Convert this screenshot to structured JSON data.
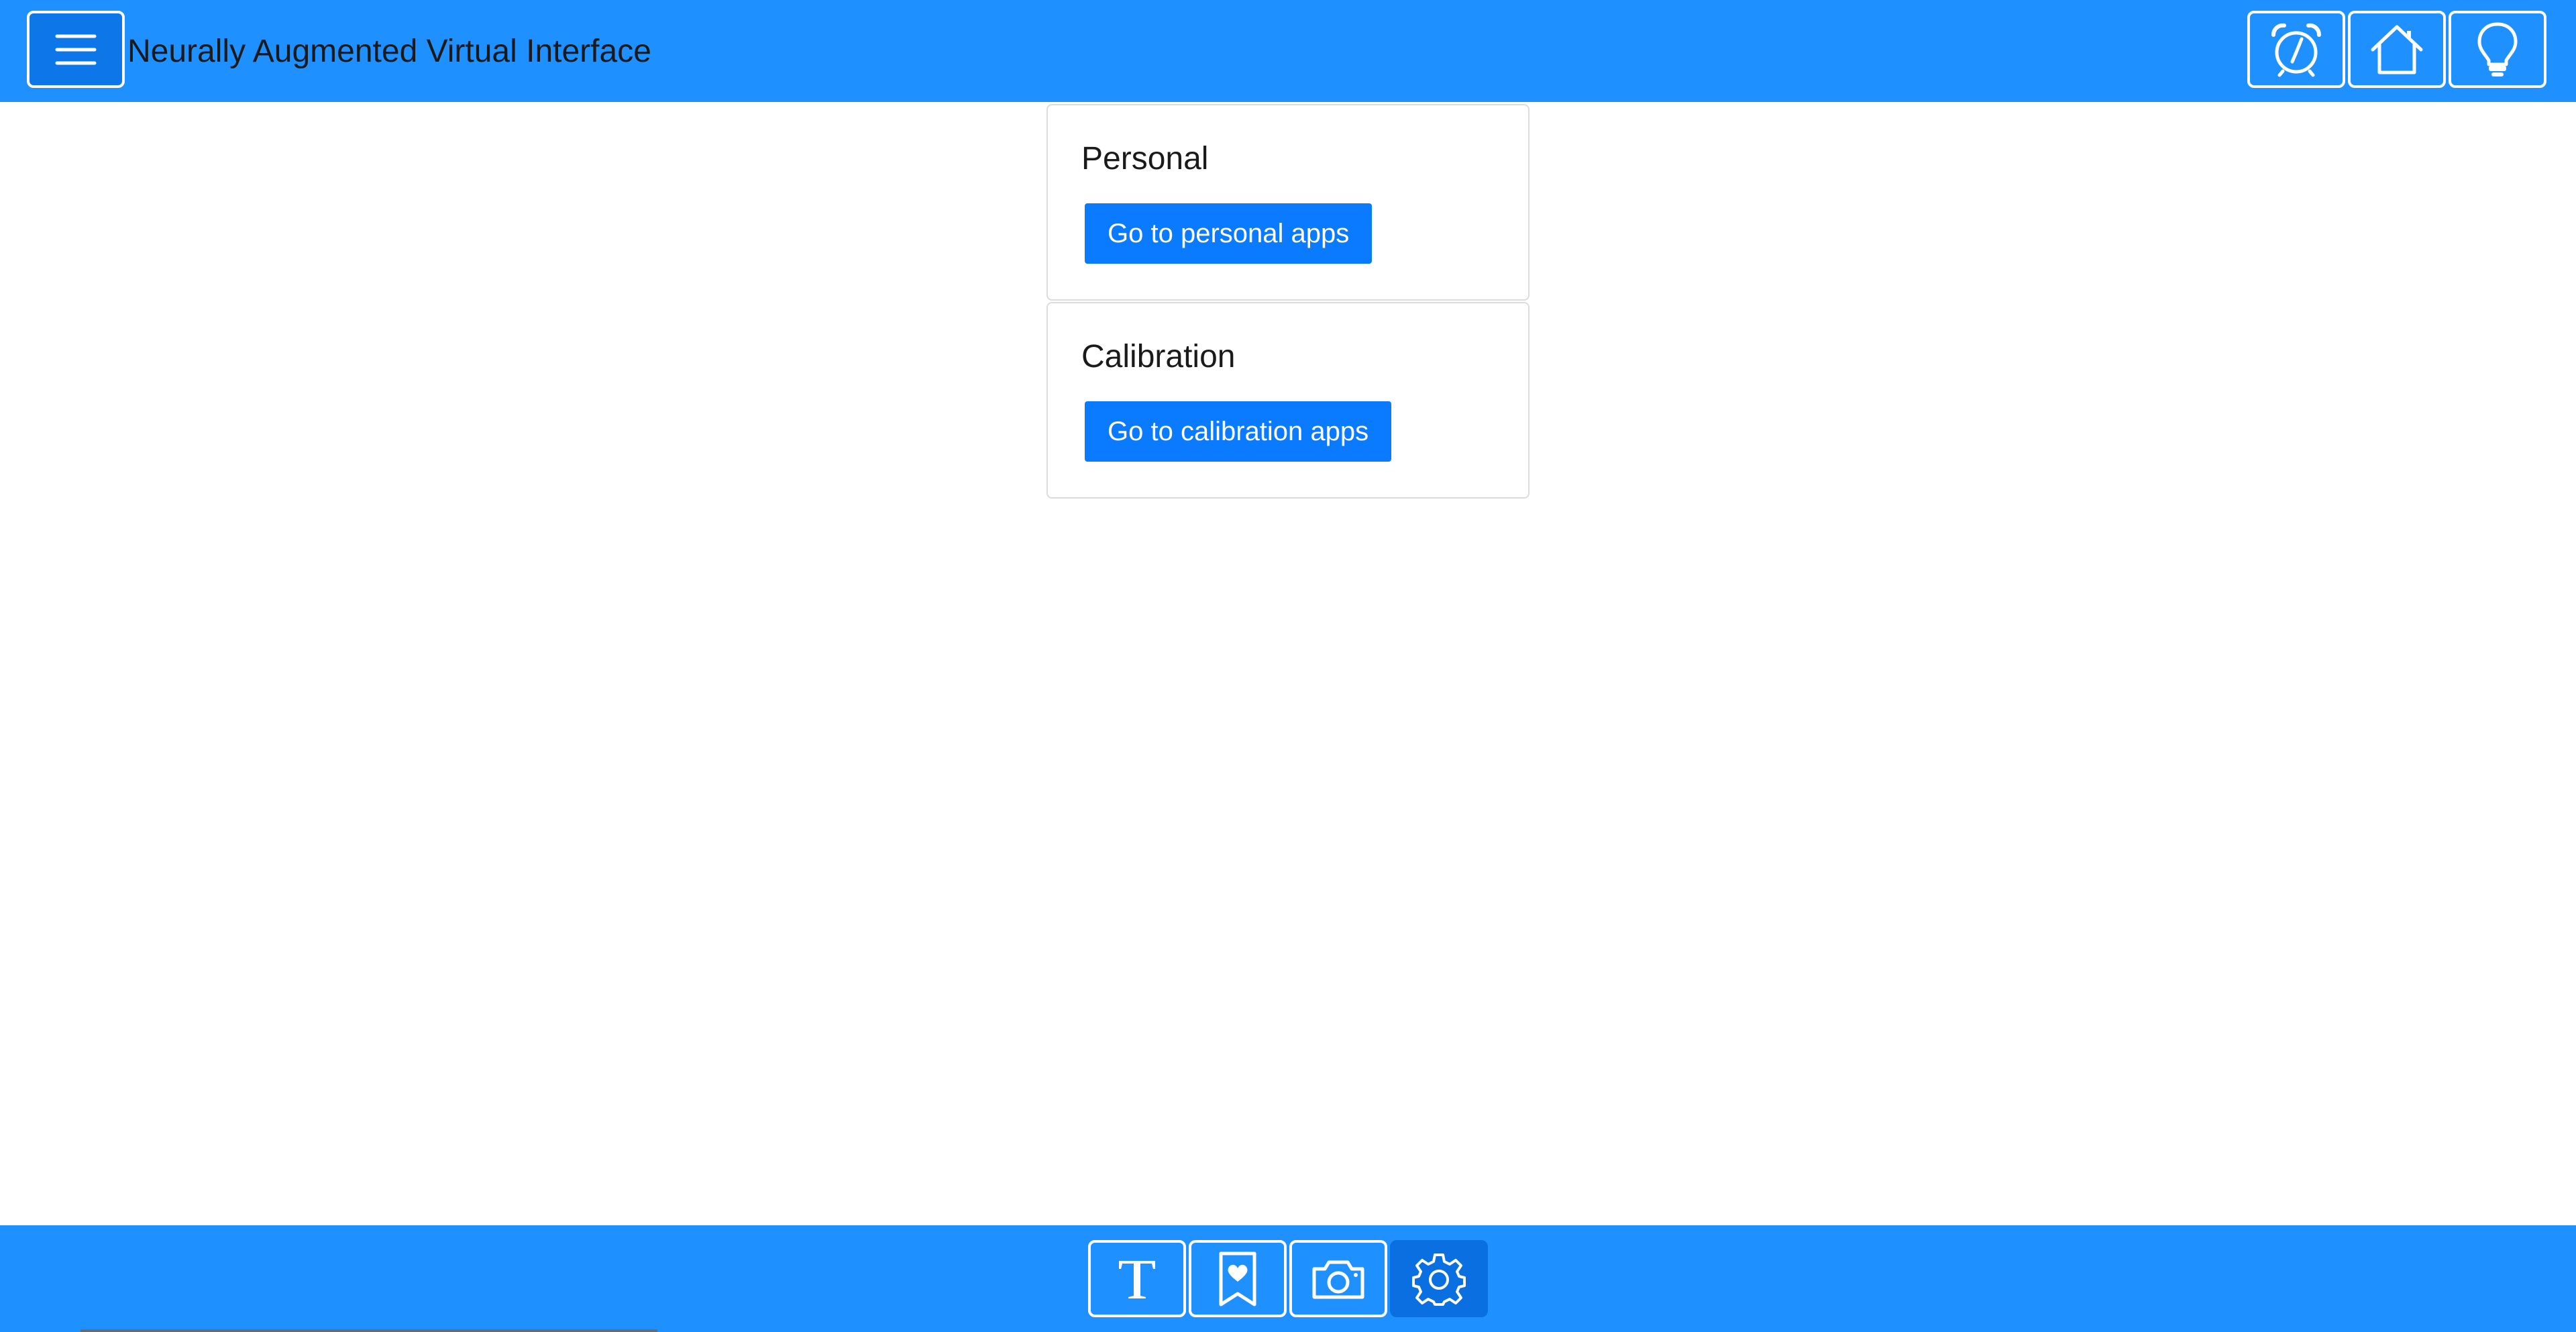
{
  "header": {
    "title": "Neurally Augmented Virtual Interface",
    "menu_icon": "hamburger-menu-icon",
    "right_icons": [
      "alarm-clock-icon",
      "home-icon",
      "lightbulb-icon"
    ]
  },
  "cards": [
    {
      "title": "Personal",
      "button_label": "Go to personal apps"
    },
    {
      "title": "Calibration",
      "button_label": "Go to calibration apps"
    }
  ],
  "footer": {
    "icons": [
      "text-icon",
      "bookmark-heart-icon",
      "camera-icon",
      "gear-icon"
    ],
    "active": "gear-icon"
  },
  "colors": {
    "bar": "#1e90ff",
    "button": "#0a7bff",
    "active": "#0a6fe0",
    "card_border": "#dcdcdc"
  }
}
